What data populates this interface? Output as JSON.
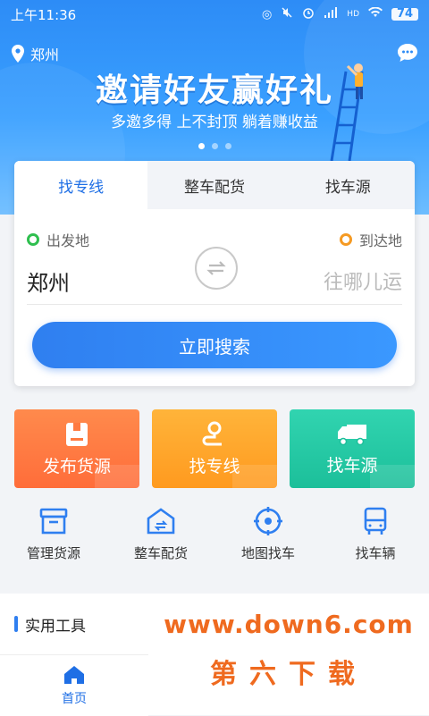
{
  "status_bar": {
    "time": "上午11:36",
    "network": "HD",
    "battery": "74"
  },
  "header": {
    "location": "郑州"
  },
  "banner": {
    "title": "邀请好友赢好礼",
    "subtitle": "多邀多得 上不封顶 躺着赚收益"
  },
  "search": {
    "tabs": [
      {
        "label": "找专线",
        "active": true
      },
      {
        "label": "整车配货",
        "active": false
      },
      {
        "label": "找车源",
        "active": false
      }
    ],
    "from_label": "出发地",
    "to_label": "到达地",
    "from_value": "郑州",
    "to_placeholder": "往哪儿运",
    "button_label": "立即搜索"
  },
  "quick_tiles": [
    {
      "label": "发布货源",
      "icon": "document-icon",
      "color": "#ff7a40"
    },
    {
      "label": "找专线",
      "icon": "route-pin-icon",
      "color": "#ffa52a"
    },
    {
      "label": "找车源",
      "icon": "truck-icon",
      "color": "#27c9a5"
    }
  ],
  "shortcuts": [
    {
      "label": "管理货源",
      "icon": "box-icon"
    },
    {
      "label": "整车配货",
      "icon": "warehouse-icon"
    },
    {
      "label": "地图找车",
      "icon": "target-icon"
    },
    {
      "label": "找车辆",
      "icon": "bus-icon"
    }
  ],
  "tools": {
    "title": "实用工具"
  },
  "watermark": {
    "url": "www.down6.com",
    "text": "第六下载"
  },
  "bottom_nav": {
    "home_label": "首页"
  },
  "colors": {
    "primary": "#2f7ff0",
    "accent_orange": "#ef6a1f"
  }
}
